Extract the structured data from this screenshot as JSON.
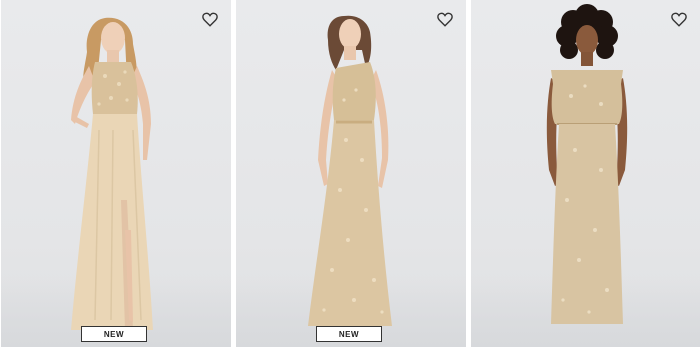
{
  "products": [
    {
      "badge": "NEW",
      "favorite_icon": "heart-outline-icon"
    },
    {
      "badge": "NEW",
      "favorite_icon": "heart-outline-icon"
    },
    {
      "badge": "",
      "favorite_icon": "heart-outline-icon"
    }
  ],
  "colors": {
    "background": "#e6e7e9",
    "chiffon": "#e9d4b3",
    "sequin_gold": "#d8c3a0",
    "skin": "#e8c3a8",
    "badge_border": "#333333"
  }
}
